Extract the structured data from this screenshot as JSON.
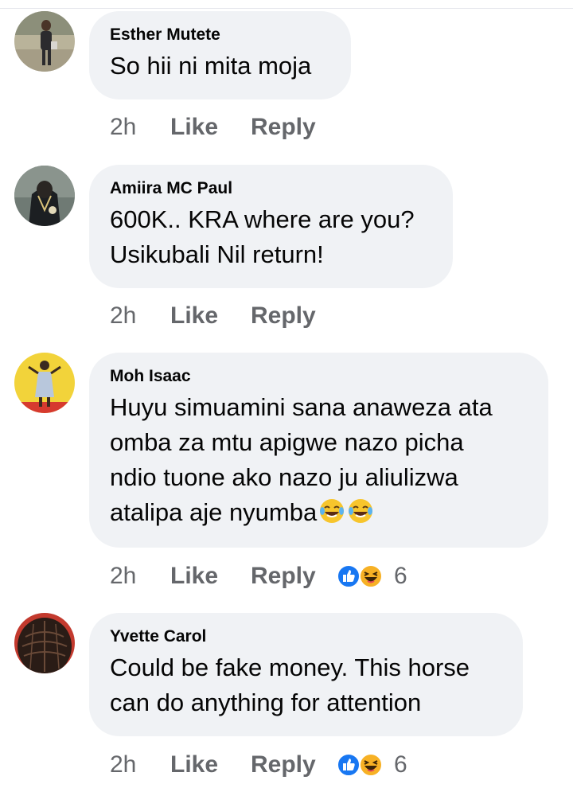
{
  "comments": [
    {
      "author": "Esther Mutete",
      "lines": [
        "So hii ni mita moja"
      ],
      "time": "2h",
      "like_label": "Like",
      "reply_label": "Reply"
    },
    {
      "author": "Amiira MC Paul",
      "lines": [
        "600K.. KRA where are you?",
        "Usikubali Nil return!"
      ],
      "time": "2h",
      "like_label": "Like",
      "reply_label": "Reply"
    },
    {
      "author": "Moh Isaac",
      "lines": [
        "Huyu simuamini sana anaweza ata",
        "omba za mtu apigwe nazo picha",
        "ndio tuone ako nazo ju aliulizwa",
        "atalipa aje nyumba"
      ],
      "trailing_emoji": [
        "laughing-tears-emoji",
        "laughing-tears-emoji"
      ],
      "time": "2h",
      "like_label": "Like",
      "reply_label": "Reply",
      "reaction_icons": [
        "like-reaction-icon",
        "haha-reaction-icon"
      ],
      "reaction_count": "6"
    },
    {
      "author": "Yvette Carol",
      "lines": [
        "Could be fake money. This horse",
        "can do anything for attention"
      ],
      "time": "2h",
      "like_label": "Like",
      "reply_label": "Reply",
      "reaction_icons": [
        "like-reaction-icon",
        "haha-reaction-icon"
      ],
      "reaction_count": "6"
    }
  ],
  "colors": {
    "bubble": "#f0f2f5",
    "text": "#050505",
    "meta": "#65676b",
    "like_blue": "#1877f2",
    "haha_yellow": "#f7b125"
  }
}
